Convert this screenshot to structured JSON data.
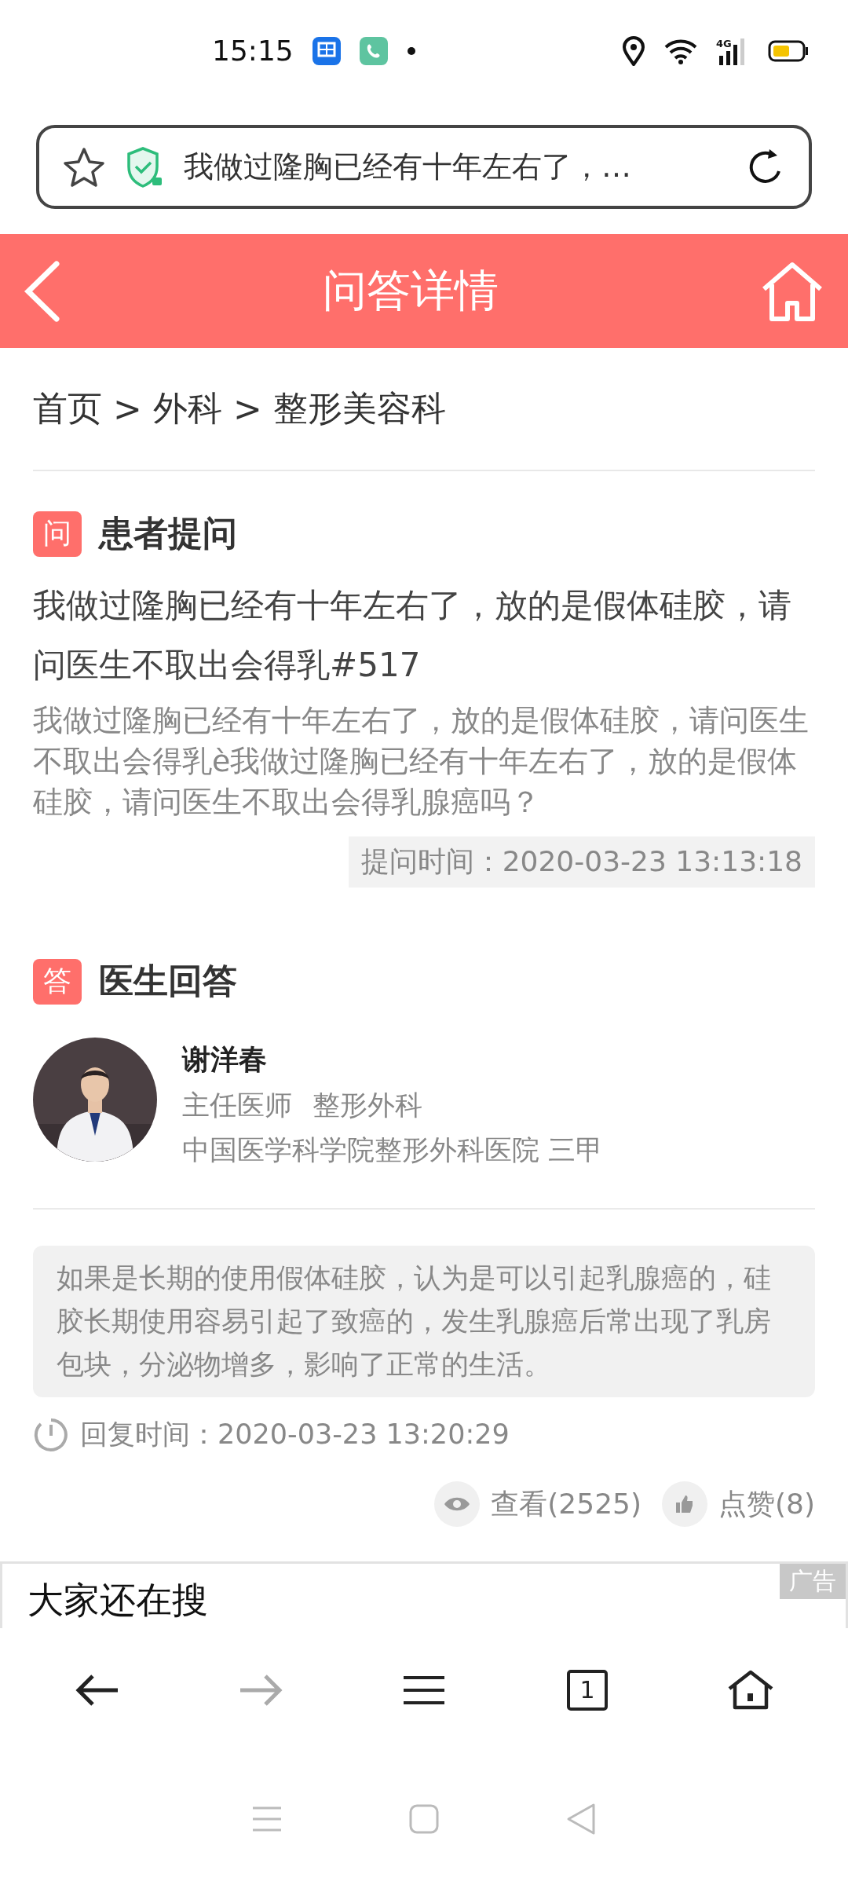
{
  "status_bar": {
    "time": "15:15",
    "network": "4G"
  },
  "address_bar": {
    "text": "我做过隆胸已经有十年左右了，…"
  },
  "header": {
    "title": "问答详情"
  },
  "breadcrumb": {
    "separator": ">",
    "items": [
      "首页",
      "外科",
      "整形美容科"
    ]
  },
  "question": {
    "badge": "问",
    "heading": "患者提问",
    "title": "我做过隆胸已经有十年左右了，放的是假体硅胶，请问医生不取出会得乳#517",
    "description": "我做过隆胸已经有十年左右了，放的是假体硅胶，请问医生不取出会得乳è我做过隆胸已经有十年左右了，放的是假体硅胶，请问医生不取出会得乳腺癌吗？",
    "time": "提问时间：2020-03-23 13:13:18"
  },
  "answer": {
    "badge": "答",
    "heading": "医生回答",
    "doctor": {
      "name": "谢洋春",
      "title": "主任医师",
      "department": "整形外科",
      "hospital": "中国医学科学院整形外科医院 三甲"
    },
    "content": "如果是长期的使用假体硅胶，认为是可以引起乳腺癌的，硅胶长期使用容易引起了致癌的，发生乳腺癌后常出现了乳房包块，分泌物增多，影响了正常的生活。",
    "reply_time": "回复时间：2020-03-23 13:20:29",
    "views": "查看(2525)",
    "likes": "点赞(8)"
  },
  "ad": {
    "badge": "广告",
    "heading": "大家还在搜"
  },
  "toolbar": [
    {
      "kind": "back",
      "disabled": false
    },
    {
      "kind": "forward",
      "disabled": true
    },
    {
      "kind": "menu",
      "disabled": false
    },
    {
      "kind": "tabs",
      "disabled": false,
      "count": "1"
    },
    {
      "kind": "home",
      "disabled": false
    }
  ]
}
